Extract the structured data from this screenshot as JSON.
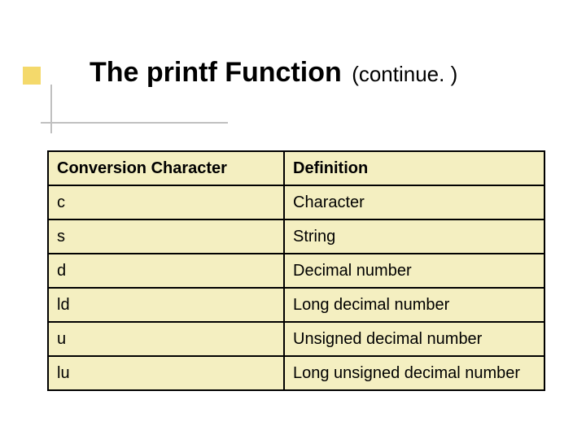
{
  "title": {
    "prefix": "The ",
    "em": "printf",
    "suffix": " Function",
    "continue": "(continue. )"
  },
  "table": {
    "headers": {
      "col1": "Conversion Character",
      "col2": "Definition"
    },
    "rows": [
      {
        "char": "c",
        "def": "Character"
      },
      {
        "char": "s",
        "def": "String"
      },
      {
        "char": "d",
        "def": "Decimal number"
      },
      {
        "char": "ld",
        "def": "Long decimal number"
      },
      {
        "char": "u",
        "def": "Unsigned decimal number"
      },
      {
        "char": "lu",
        "def": "Long unsigned decimal number"
      }
    ]
  }
}
